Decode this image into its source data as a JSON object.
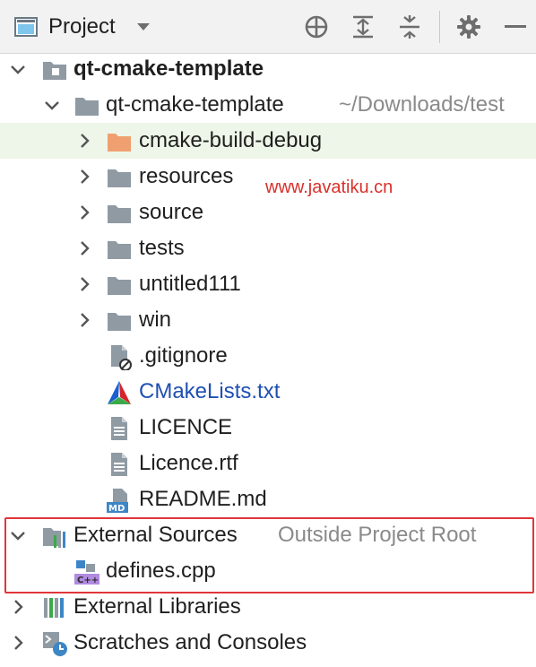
{
  "toolbar": {
    "title": "Project",
    "icons": [
      "project-window-icon",
      "dropdown-icon",
      "locate-icon",
      "expand-all-icon",
      "collapse-all-icon",
      "settings-icon",
      "hide-icon"
    ]
  },
  "watermark": "www.javatiku.cn",
  "tree": {
    "root": {
      "label": "qt-cmake-template"
    },
    "module": {
      "label": "qt-cmake-template",
      "path": "~/Downloads/test"
    },
    "folders": [
      "cmake-build-debug",
      "resources",
      "source",
      "tests",
      "untitled111",
      "win"
    ],
    "files": [
      ".gitignore",
      "CMakeLists.txt",
      "LICENCE",
      "Licence.rtf",
      "README.md"
    ],
    "external_sources": {
      "label": "External Sources",
      "hint": "Outside Project Root",
      "child": "defines.cpp"
    },
    "external_libraries": "External Libraries",
    "scratches": "Scratches and Consoles"
  },
  "colors": {
    "selected_row": "#edf6e8",
    "excluded_folder": "#f0a070",
    "folder": "#8f9aa3",
    "cmake_blue": "#1f4fb3",
    "highlight": "#e0363a"
  }
}
